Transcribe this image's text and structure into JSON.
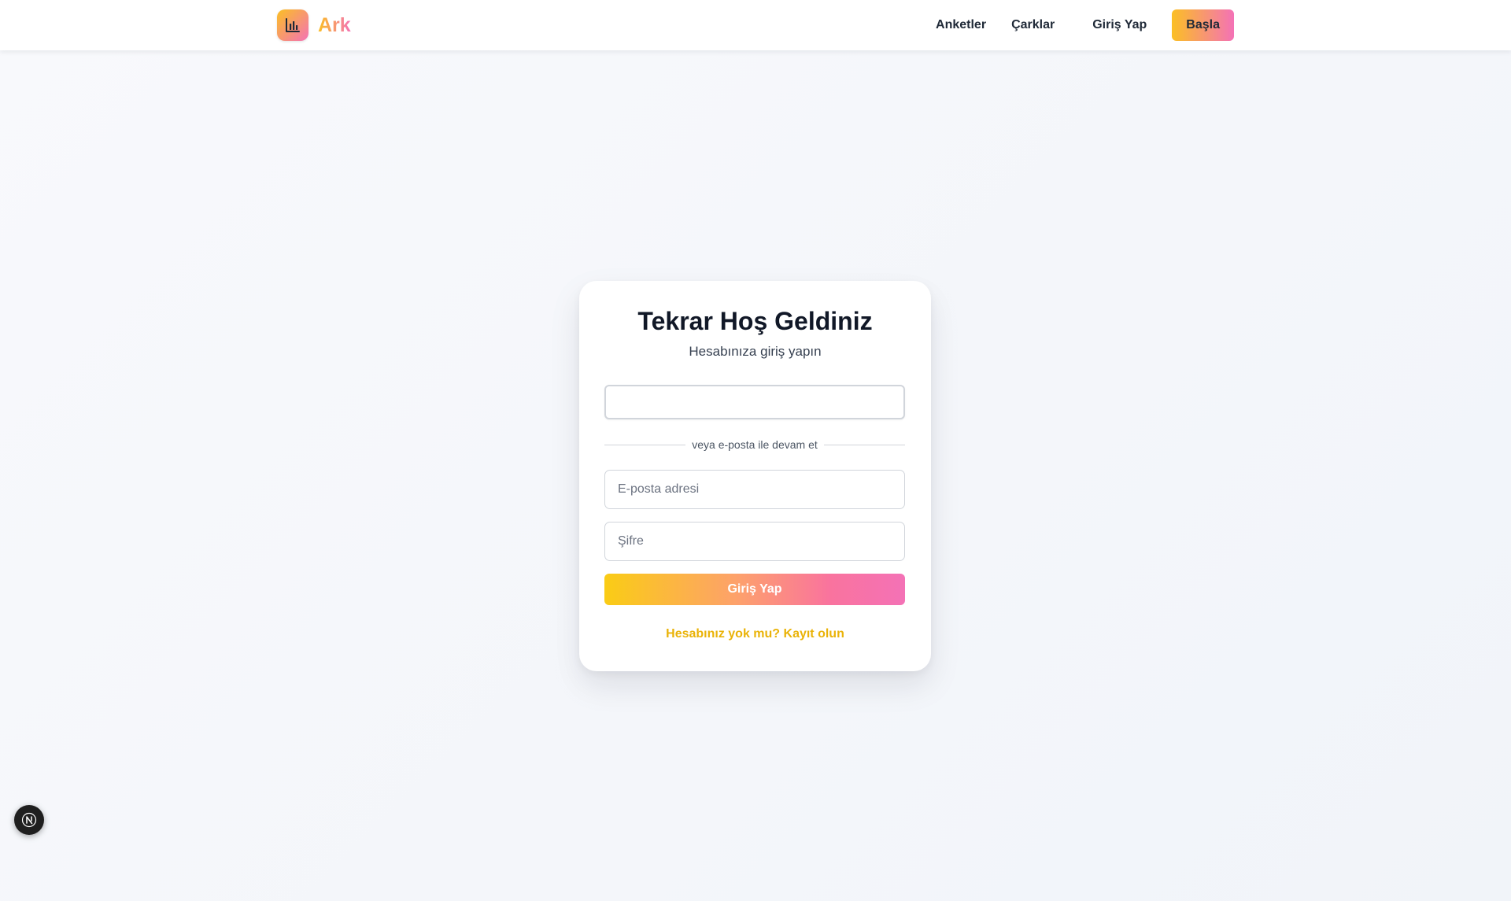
{
  "brand": {
    "name": "Ark",
    "logo_icon": "bar-chart-icon",
    "gradient_from": "#fbbf24",
    "gradient_to": "#f472b6"
  },
  "nav": {
    "links": [
      "Anketler",
      "Çarklar",
      "Giriş Yap"
    ],
    "cta_label": "Başla"
  },
  "login": {
    "title": "Tekrar Hoş Geldiniz",
    "subtitle": "Hesabınıza giriş yapın",
    "divider_text": "veya e-posta ile devam et",
    "email_placeholder": "E-posta adresi",
    "email_value": "",
    "password_placeholder": "Şifre",
    "password_value": "",
    "submit_label": "Giriş Yap",
    "register_text": "Hesabınız yok mu? Kayıt olun"
  },
  "dev_badge": {
    "icon": "nextjs-icon"
  },
  "colors": {
    "accent_yellow": "#facc15",
    "accent_pink": "#f472b6",
    "link_color": "#eab308",
    "background": "#f4f6fb"
  }
}
